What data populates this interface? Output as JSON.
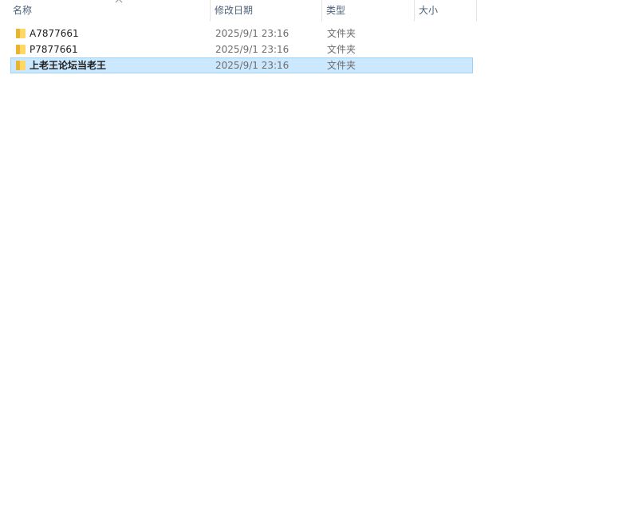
{
  "columns": {
    "name": "名称",
    "date": "修改日期",
    "type": "类型",
    "size": "大小"
  },
  "sort": {
    "column": "name",
    "direction": "ascending",
    "icon": "chevron-up-icon"
  },
  "rows": [
    {
      "name": "A7877661",
      "date": "2025/9/1 23:16",
      "type": "文件夹",
      "size": "",
      "icon": "folder-icon",
      "selected": false
    },
    {
      "name": "P7877661",
      "date": "2025/9/1 23:16",
      "type": "文件夹",
      "size": "",
      "icon": "folder-icon",
      "selected": false
    },
    {
      "name": "上老王论坛当老王",
      "date": "2025/9/1 23:16",
      "type": "文件夹",
      "size": "",
      "icon": "folder-icon",
      "selected": true
    }
  ],
  "colors": {
    "header_text": "#4c607a",
    "selection_bg": "#cce8ff",
    "selection_border": "#99d1ff",
    "folder_fill": "#ffd766",
    "folder_tab": "#e8b530"
  }
}
